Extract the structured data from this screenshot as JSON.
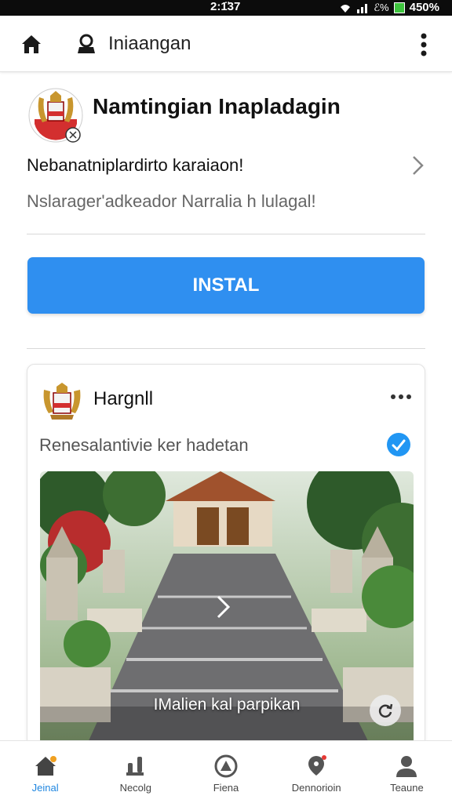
{
  "status_bar": {
    "time": "2:1̈37",
    "battery": "450%",
    "extra": "ℰ%"
  },
  "app_bar": {
    "title": "Iniaangan"
  },
  "header": {
    "title": "Namtingian Inapladagin"
  },
  "description": {
    "line1": "Nebanatniplardirto karaiaon!",
    "line2": "Nslarager'adkeador Narralia h lulagal!"
  },
  "install_button": {
    "label": "INSTAL"
  },
  "card": {
    "name": "Hargnll",
    "caption": "Renesalantivie ker hadetan",
    "photo_caption": "IMalien kal parpikan"
  },
  "bottom_nav": [
    {
      "label": "Jeinal",
      "icon": "home-icon",
      "active": true
    },
    {
      "label": "Necolg",
      "icon": "people-icon",
      "active": false
    },
    {
      "label": "Fiena",
      "icon": "compass-icon",
      "active": false
    },
    {
      "label": "Dennorioin",
      "icon": "notification-icon",
      "active": false
    },
    {
      "label": "Teaune",
      "icon": "profile-icon",
      "active": false
    }
  ],
  "colors": {
    "accent": "#2f8ff0",
    "active_nav": "#1f86e0"
  }
}
